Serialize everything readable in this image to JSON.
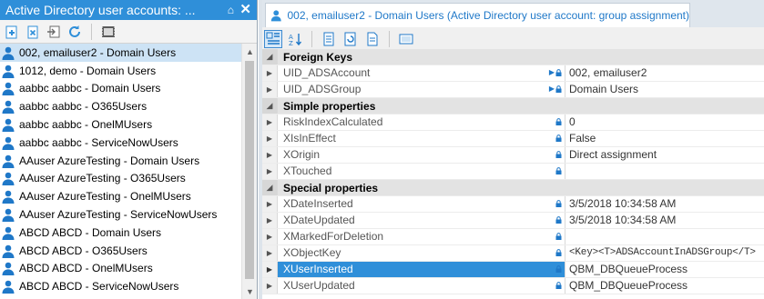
{
  "left_panel": {
    "title": "Active Directory user accounts: ...",
    "pin_glyph": "⌂",
    "close_glyph": "✕",
    "items": [
      "002, emailuser2 - Domain Users",
      "1012, demo - Domain Users",
      "aabbc aabbc - Domain Users",
      "aabbc aabbc - O365Users",
      "aabbc aabbc - OnelMUsers",
      "aabbc aabbc - ServiceNowUsers",
      "AAuser AzureTesting - Domain Users",
      "AAuser AzureTesting - O365Users",
      "AAuser AzureTesting - OnelMUsers",
      "AAuser AzureTesting - ServiceNowUsers",
      "ABCD ABCD - Domain Users",
      "ABCD ABCD - O365Users",
      "ABCD ABCD - OnelMUsers",
      "ABCD ABCD - ServiceNowUsers"
    ],
    "selected_index": 0
  },
  "right_panel": {
    "tab_title": "002, emailuser2 - Domain Users (Active Directory user account: group assignment)",
    "categories": [
      {
        "label": "Foreign Keys",
        "rows": [
          {
            "name": "UID_ADSAccount",
            "value": "002, emailuser2"
          },
          {
            "name": "UID_ADSGroup",
            "value": "Domain Users"
          }
        ]
      },
      {
        "label": "Simple properties",
        "rows": [
          {
            "name": "RiskIndexCalculated",
            "value": "0"
          },
          {
            "name": "XIsInEffect",
            "value": "False"
          },
          {
            "name": "XOrigin",
            "value": "Direct assignment"
          },
          {
            "name": "XTouched",
            "value": ""
          }
        ]
      },
      {
        "label": "Special properties",
        "rows": [
          {
            "name": "XDateInserted",
            "value": "3/5/2018 10:34:58 AM"
          },
          {
            "name": "XDateUpdated",
            "value": "3/5/2018 10:34:58 AM"
          },
          {
            "name": "XMarkedForDeletion",
            "value": ""
          },
          {
            "name": "XObjectKey",
            "value": "<Key><T>ADSAccountInADSGroup</T>"
          },
          {
            "name": "XUserInserted",
            "value": "QBM_DBQueueProcess"
          },
          {
            "name": "XUserUpdated",
            "value": "QBM_DBQueueProcess"
          }
        ]
      }
    ]
  },
  "colors": {
    "accent": "#2f8fd9",
    "selection_light": "#cde3f5",
    "category_bg": "#e3e3e3"
  }
}
